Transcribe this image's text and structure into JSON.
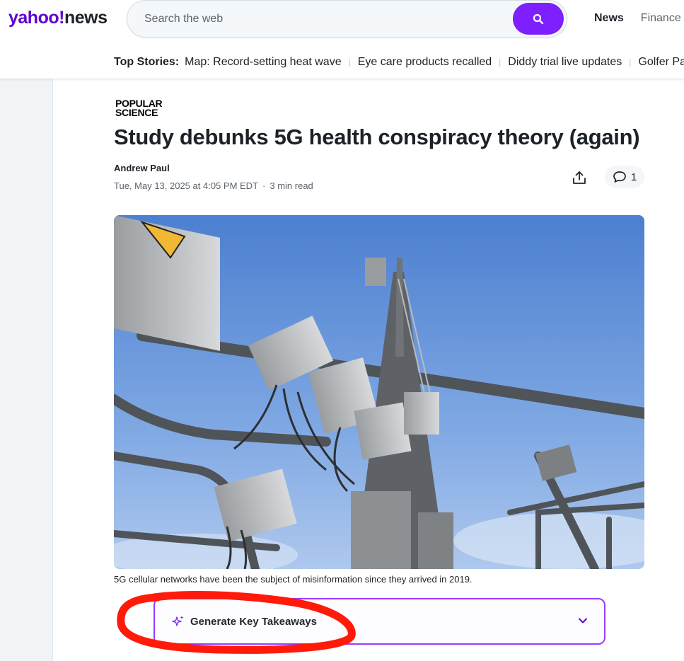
{
  "header": {
    "logo_yahoo": "yahoo!",
    "logo_news": "news",
    "search_placeholder": "Search the web",
    "nav": [
      {
        "label": "News",
        "active": true
      },
      {
        "label": "Finance",
        "active": false
      }
    ]
  },
  "top_stories": {
    "label": "Top Stories:",
    "items": [
      "Map: Record-setting heat wave",
      "Eye care products recalled",
      "Diddy trial live updates",
      "Golfer Pau"
    ]
  },
  "article": {
    "publisher_line1": "POPULAR",
    "publisher_line2": "SCIENCE",
    "title": "Study debunks 5G health conspiracy theory (again)",
    "author": "Andrew Paul",
    "date": "Tue, May 13, 2025 at 4:05 PM EDT",
    "read_time": "3 min read",
    "comment_count": "1",
    "caption": "5G cellular networks have been the subject of misinformation since they arrived in 2019."
  },
  "takeaways": {
    "label": "Generate Key Takeaways"
  },
  "colors": {
    "brand": "#6001d2",
    "search_button": "#7e1fff",
    "takeaways_border": "#9a3cff",
    "annotation": "#ff1a0a"
  },
  "icons": [
    "search-icon",
    "share-icon",
    "comment-icon",
    "sparkle-icon",
    "chevron-down-icon"
  ]
}
